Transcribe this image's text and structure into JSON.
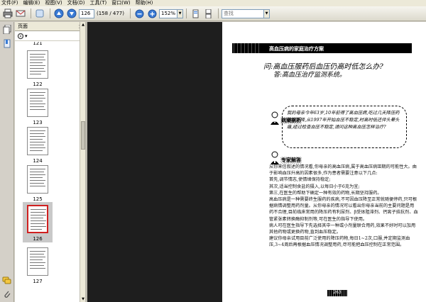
{
  "menu": {
    "items": [
      "文件(F)",
      "编辑(E)",
      "视图(V)",
      "文档(D)",
      "工具(T)",
      "窗口(W)",
      "帮助(H)"
    ]
  },
  "toolbar": {
    "page_current": "126",
    "page_total": "(158 / 477)",
    "zoom": "152%",
    "search_placeholder": "查找"
  },
  "panel": {
    "title": "页面",
    "close": "×",
    "options_label": "▾"
  },
  "thumbnails": [
    {
      "label": "121"
    },
    {
      "label": "122"
    },
    {
      "label": "123"
    },
    {
      "label": "124"
    },
    {
      "label": "125"
    },
    {
      "label": "126",
      "selected": true
    },
    {
      "label": "127"
    }
  ],
  "document": {
    "header_title": "高血压病的家庭治疗方案",
    "question": "问:高血压服药后血压仍高时低怎么办?",
    "answer": "答:高血压治疗监测系统。",
    "section_case": "病案剖析",
    "case_text": "我的母亲今年63岁,10年前得了高血压病,吃过几天降压药血压下降,从1997年开始血压不稳定,时高时低还伴头晕头痛,经过检查血压不稳定,请问这种高血压怎样治疗?",
    "section_answer": "专家解答",
    "body_paragraphs": [
      "从你来信叙述的情况看,你母亲的高血压病,属于高血压病Ⅲ期的可能性大。由于影响血压升高的因素很多,作为患者需要注意以下几点:",
      "首先,调节情志,使情绪保持稳定;",
      "其次,适当控制食盐的摄入,以每日小于6克为宜;",
      "第三,在医生的帮助下确定一种有效的药物,长期坚持服药。",
      "高血压病是一种需要终生服药的疾病,不可因血压降至正常就随便停药,只可根据病情调整用药剂量。从你母亲的情况可以看出你母亲当前的主要问题是用药不合理,目前临床常用的降压药有利尿剂、β受体阻滞剂、钙离子拮抗剂、血管紧张素转换酶抑制剂等,可在医生的指导下使用。",
      "病人可在医生指导下先选择其中一种或小剂量联合用药,效果不好时可以加用其他药物或更换药物,直到血压稳定。",
      "建议你母亲试用目前广泛使用的降压药物,每日1~2次,口服,并定期监测血压,3~4周后再根据血压情况调整用药,尽可能把血压控制在正常范围。"
    ],
    "page_number": "263"
  }
}
